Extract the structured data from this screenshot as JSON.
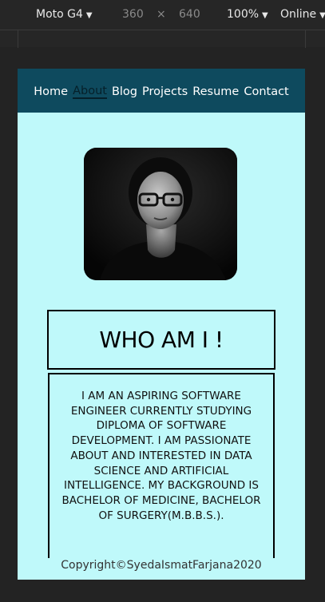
{
  "devtools": {
    "device": "Moto G4",
    "width": "360",
    "times": "×",
    "height": "640",
    "zoom": "100%",
    "network": "Online",
    "caret": "▼"
  },
  "nav": {
    "items": [
      "Home",
      "About",
      "Blog",
      "Projects",
      "Resume",
      "Contact"
    ],
    "active": "About"
  },
  "profile": {
    "photo_alt": "Profile photo"
  },
  "heading": "WHO AM I !",
  "bio": "I AM AN ASPIRING SOFTWARE ENGINEER CURRENTLY STUDYING DIPLOMA OF SOFTWARE DEVELOPMENT. I AM PASSIONATE ABOUT AND INTERESTED IN DATA SCIENCE AND ARTIFICIAL INTELLIGENCE. MY BACKGROUND IS BACHELOR OF MEDICINE, BACHELOR OF SURGERY(M.B.B.S.).",
  "footer": "Copyright©SyedaIsmatFarjana2020",
  "colors": {
    "nav_bg": "#0e4a5e",
    "page_bg": "#bff9fa",
    "chrome_bg": "#232323"
  }
}
